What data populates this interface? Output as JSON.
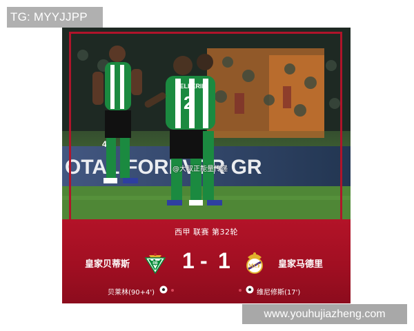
{
  "watermark": {
    "tag": "TG: MYYJJPP",
    "url": "www.youhujiazheng.com"
  },
  "photo": {
    "weibo_handle": "@大叔正能量传递",
    "banner_text": "OTAL FOREVER GR",
    "jersey_name": "BELLERIN",
    "jersey_number_1": "2",
    "jersey_number_2": "4"
  },
  "match": {
    "league": "西甲 联赛 第32轮",
    "home_team": "皇家贝蒂斯",
    "away_team": "皇家马德里",
    "home_score": "1",
    "separator": "-",
    "away_score": "1",
    "home_scorer": "贝莱林(90+4')",
    "away_scorer": "维尼修斯(17')"
  },
  "colors": {
    "panel_red": "#a10f22",
    "frame_red": "#b0142a",
    "betis_green": "#0a8f3c",
    "madrid_gold": "#e1b12c"
  },
  "icons": {
    "home_crest": "real-betis-crest-icon",
    "away_crest": "real-madrid-crest-icon",
    "goal": "soccer-ball-icon"
  }
}
